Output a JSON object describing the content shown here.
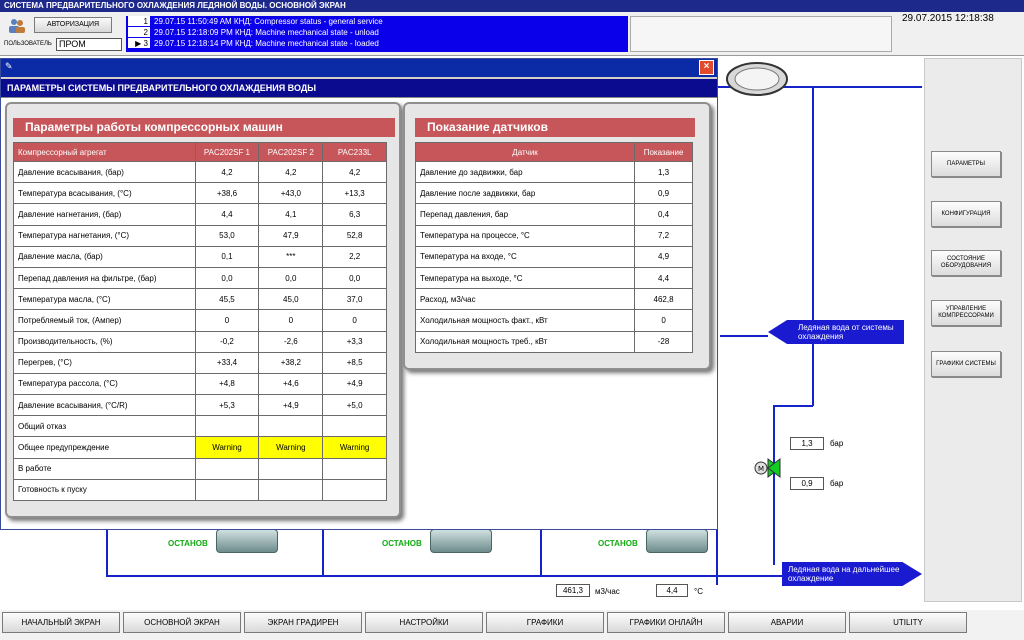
{
  "window_title": "СИСТЕМА ПРЕДВАРИТЕЛЬНОГО ОХЛАЖДЕНИЯ ЛЕДЯНОЙ ВОДЫ. ОСНОВНОЙ ЭКРАН",
  "header": {
    "auth_button": "АВТОРИЗАЦИЯ",
    "user_label": "ПОЛЬЗОВАТЕЛЬ",
    "user_value": "ПРОМ",
    "datetime": "29.07.2015 12:18:38",
    "alarms": [
      {
        "num": "1",
        "text": "29.07.15     11:50:49 AM  КНД: Compressor status - general service"
      },
      {
        "num": "2",
        "text": "29.07.15     12:18:09 PM  КНД: Machine mechanical state - unload"
      },
      {
        "num": "3",
        "text": "29.07.15     12:18:14 PM  КНД: Machine mechanical state - loaded"
      }
    ]
  },
  "sidebar": {
    "buttons": [
      "ПАРАМЕТРЫ",
      "КОНФИГУРАЦИЯ",
      "СОСТОЯНИЕ ОБОРУДОВАНИЯ",
      "УПРАВЛЕНИЕ КОМПРЕССОРАМИ",
      "ГРАФИКИ СИСТЕМЫ"
    ]
  },
  "process": {
    "ice_water_in": "Ледяная вода от системы охлаждения",
    "ice_water_out": "Ледяная вода на дальнейшее охлаждение",
    "pressure_1": "1,3",
    "pressure_2": "0,9",
    "pressure_unit": "бар",
    "flow_value": "461,3",
    "flow_unit": "м3/час",
    "temp_value": "4,4",
    "temp_unit": "°C",
    "comp_state": "ОСТАНОВ"
  },
  "nav": [
    "НАЧАЛЬНЫЙ ЭКРАН",
    "ОСНОВНОЙ ЭКРАН",
    "ЭКРАН ГРАДИРЕН",
    "НАСТРОЙКИ",
    "ГРАФИКИ",
    "ГРАФИКИ ОНЛАЙН",
    "АВАРИИ",
    "UTILITY"
  ],
  "dialog": {
    "title": "ПАРАМЕТРЫ СИСТЕМЫ ПРЕДВАРИТЕЛЬНОГО ОХЛАЖДЕНИЯ ВОДЫ",
    "close": "×",
    "compressors": {
      "heading": "Параметры работы компрессорных машин",
      "columns": [
        "Компрессорный агрегат",
        "PAC202SF 1",
        "PAC202SF 2",
        "PAC233L"
      ],
      "rows": [
        [
          "Давление всасывания, (бар)",
          "4,2",
          "4,2",
          "4,2"
        ],
        [
          "Температура всасывания, (°C)",
          "+38,6",
          "+43,0",
          "+13,3"
        ],
        [
          "Давление нагнетания, (бар)",
          "4,4",
          "4,1",
          "6,3"
        ],
        [
          "Температура нагнетания, (°C)",
          "53,0",
          "47,9",
          "52,8"
        ],
        [
          "Давление масла, (бар)",
          "0,1",
          "***",
          "2,2"
        ],
        [
          "Перепад давления на фильтре, (бар)",
          "0,0",
          "0,0",
          "0,0"
        ],
        [
          "Температура масла,  (°C)",
          "45,5",
          "45,0",
          "37,0"
        ],
        [
          "Потребляемый ток, (Ампер)",
          "0",
          "0",
          "0"
        ],
        [
          "Производительность, (%)",
          "-0,2",
          "-2,6",
          "+3,3"
        ],
        [
          "Перегрев, (°C)",
          "+33,4",
          "+38,2",
          "+8,5"
        ],
        [
          "Температура рассола, (°C)",
          "+4,8",
          "+4,6",
          "+4,9"
        ],
        [
          "Давление всасывания, (°C/R)",
          "+5,3",
          "+4,9",
          "+5,0"
        ],
        [
          "Общий отказ",
          "",
          "",
          ""
        ],
        [
          "Общее предупреждение",
          "Warning",
          "Warning",
          "Warning"
        ],
        [
          "В работе",
          "",
          "",
          ""
        ],
        [
          "Готовность к пуску",
          "",
          "",
          ""
        ]
      ]
    },
    "sensors": {
      "heading": "Показание датчиков",
      "columns": [
        "Датчик",
        "Показание"
      ],
      "rows": [
        [
          "Давление до задвижки, бар",
          "1,3"
        ],
        [
          "Давление после задвижки, бар",
          "0,9"
        ],
        [
          "Перепад давления, бар",
          "0,4"
        ],
        [
          "Температура на процессе, °C",
          "7,2"
        ],
        [
          "Температура на входе, °C",
          "4,9"
        ],
        [
          "Температура на выходе, °C",
          "4,4"
        ],
        [
          "Расход, м3/час",
          "462,8"
        ],
        [
          "Холодильная мощность факт., кВт",
          "0"
        ],
        [
          "Холодильная мощность треб., кВт",
          "-28"
        ]
      ]
    }
  },
  "colors": {
    "title_bar": "#1d2a8c",
    "alarm_bg": "#0a00ea",
    "panel_header": "#c6565a",
    "warning": "#ffff00",
    "pipe": "#1424c8",
    "stopped": "#11aa11"
  }
}
